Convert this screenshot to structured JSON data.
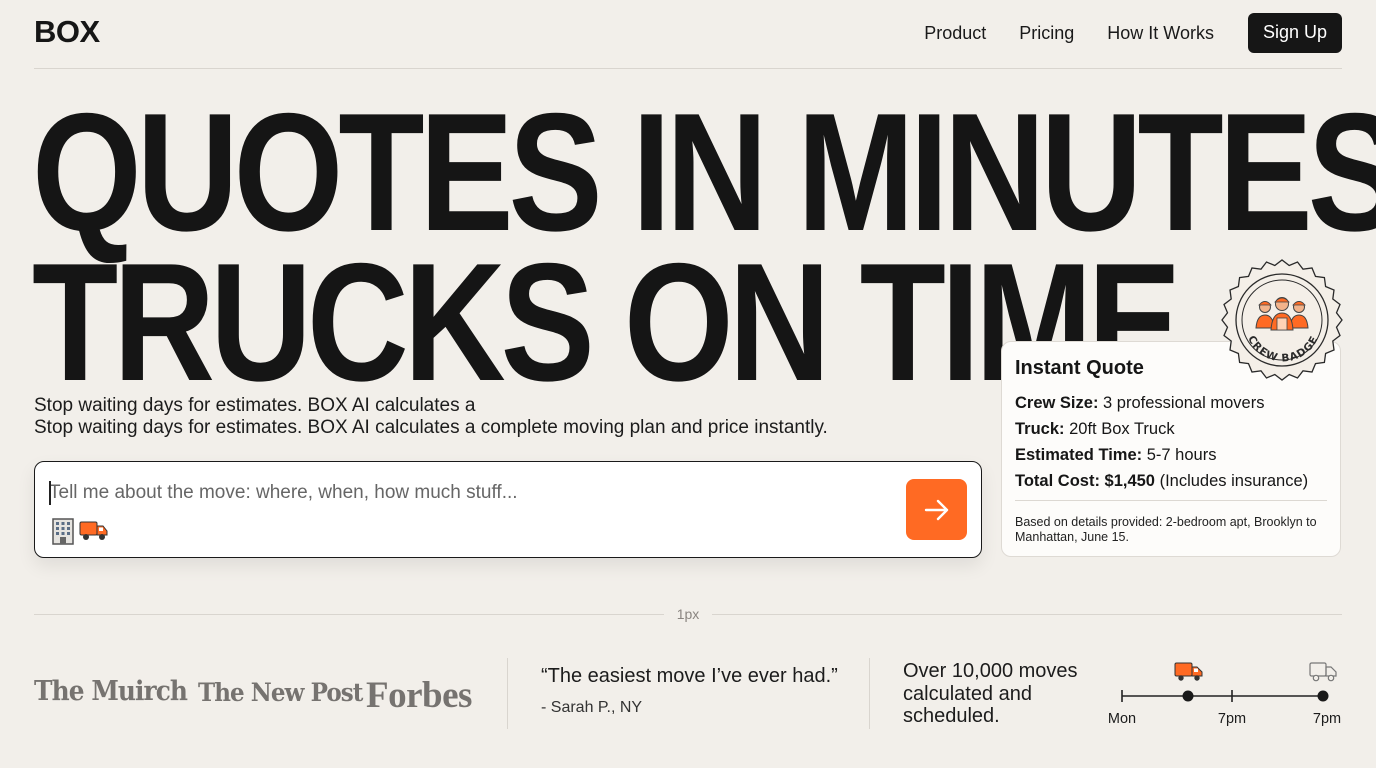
{
  "brand": {
    "logo": "BOX",
    "accent": "#ff6a23"
  },
  "nav": {
    "items": [
      "Product",
      "Pricing",
      "How It Works"
    ],
    "cta": "Sign Up"
  },
  "hero": {
    "headline_line1": "QUOTES IN MINUTES.",
    "headline_line2": "TRUCKS ON TIME",
    "subtext_line1": "Stop waiting days for estimates. BOX AI calculates a",
    "subtext_line2": "Stop waiting days for estimates. BOX AI calculates a complete moving plan and price instantly."
  },
  "input": {
    "placeholder": "Tell me about the move: where, when, how much stuff...",
    "icons": [
      "building-icon",
      "truck-icon"
    ],
    "send_icon": "arrow-right-icon"
  },
  "quote": {
    "title": "Instant Quote",
    "rows": [
      {
        "label": "Crew Size:",
        "value": " 3 professional movers"
      },
      {
        "label": "Truck:",
        "value": " 20ft Box Truck"
      },
      {
        "label": "Estimated Time:",
        "value": " 5-7 hours"
      },
      {
        "label": "Total Cost: $1,450",
        "value": " (Includes insurance)"
      }
    ],
    "note": "Based on details provided: 2-bedroom apt, Brooklyn to Manhattan, June 15."
  },
  "badge": {
    "text": "CREW BADGE"
  },
  "divider": {
    "label": "1px"
  },
  "press": [
    "The Muirch",
    "The New Post",
    "Forbes"
  ],
  "testimonial": {
    "quote": "“The easiest move I’ve ever had.”",
    "author": "- Sarah P., NY"
  },
  "stat": {
    "line1": "Over 10,000 moves",
    "line2": "calculated and",
    "line3": "scheduled."
  },
  "timeline": {
    "labels": [
      "Mon",
      "7pm",
      "7pm"
    ]
  }
}
